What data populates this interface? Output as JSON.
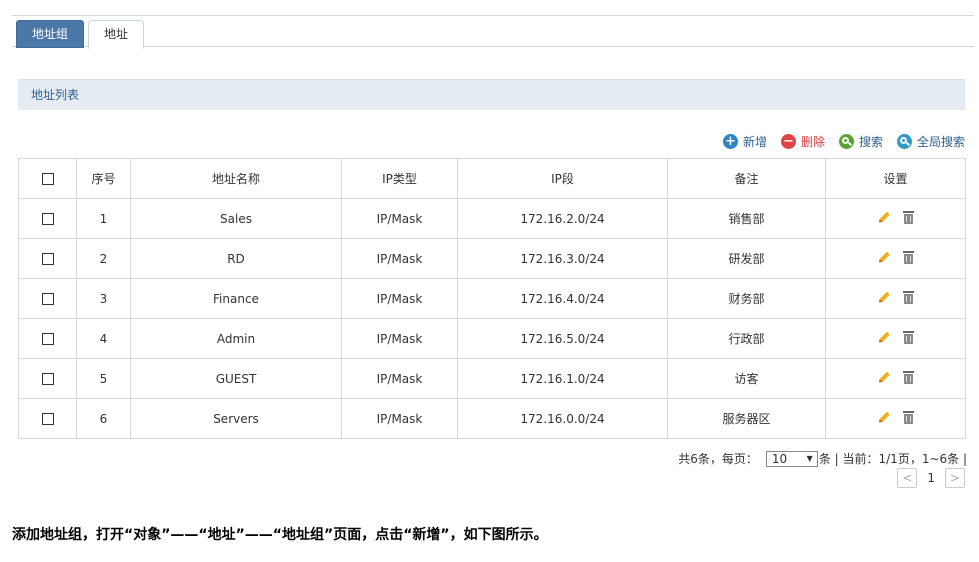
{
  "tabs": [
    {
      "label": "地址组",
      "active": false
    },
    {
      "label": "地址",
      "active": true
    }
  ],
  "section_title": "地址列表",
  "toolbar": {
    "add": "新增",
    "delete": "删除",
    "search": "搜索",
    "global_search": "全局搜索"
  },
  "table": {
    "headers": [
      "序号",
      "地址名称",
      "IP类型",
      "IP段",
      "备注",
      "设置"
    ],
    "rows": [
      {
        "no": "1",
        "name": "Sales",
        "type": "IP/Mask",
        "ip": "172.16.2.0/24",
        "note": "销售部"
      },
      {
        "no": "2",
        "name": "RD",
        "type": "IP/Mask",
        "ip": "172.16.3.0/24",
        "note": "研发部"
      },
      {
        "no": "3",
        "name": "Finance",
        "type": "IP/Mask",
        "ip": "172.16.4.0/24",
        "note": "财务部"
      },
      {
        "no": "4",
        "name": "Admin",
        "type": "IP/Mask",
        "ip": "172.16.5.0/24",
        "note": "行政部"
      },
      {
        "no": "5",
        "name": "GUEST",
        "type": "IP/Mask",
        "ip": "172.16.1.0/24",
        "note": "访客"
      },
      {
        "no": "6",
        "name": "Servers",
        "type": "IP/Mask",
        "ip": "172.16.0.0/24",
        "note": "服务器区"
      }
    ]
  },
  "pager": {
    "total_prefix": "共6条，每页：",
    "per_page": "10",
    "summary": "条 | 当前：1/1页，1~6条 |",
    "current_page": "1",
    "prev": "<",
    "next": ">"
  },
  "caption": "添加地址组，打开“对象”——“地址”——“地址组”页面，点击“新增”，如下图所示。"
}
